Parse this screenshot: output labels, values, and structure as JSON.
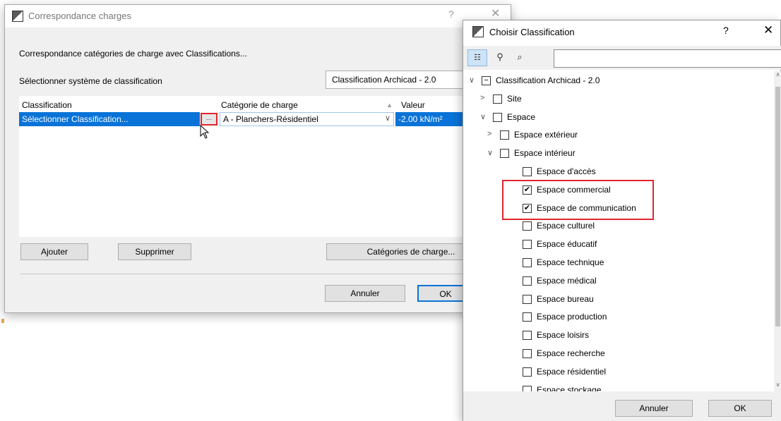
{
  "dialog1": {
    "title": "Correspondance charges",
    "help": "?",
    "close": "✕",
    "heading": "Correspondance catégories de charge avec Classifications...",
    "select_label": "Sélectionner système de classification",
    "select_value": "Classification Archicad - 2.0",
    "columns": {
      "classification": "Classification",
      "category": "Catégorie de charge",
      "value": "Valeur"
    },
    "row": {
      "classification": "Sélectionner Classification...",
      "dots": "...",
      "category": "A - Planchers-Résidentiel",
      "value": "-2.00 kN/m²"
    },
    "buttons": {
      "add": "Ajouter",
      "remove": "Supprimer",
      "categories": "Catégories de charge...",
      "cancel": "Annuler",
      "ok": "OK"
    }
  },
  "dialog2": {
    "title": "Choisir Classification",
    "help": "?",
    "close": "✕",
    "search_value": "",
    "tree": [
      {
        "label": "Classification Archicad - 2.0",
        "arrow": "∨",
        "check": "−",
        "level": 0
      },
      {
        "label": "Site",
        "arrow": ">",
        "check": "",
        "level": 1
      },
      {
        "label": "Espace",
        "arrow": "∨",
        "check": "",
        "level": 1
      },
      {
        "label": "Espace extérieur",
        "arrow": ">",
        "check": "",
        "level": 2
      },
      {
        "label": "Espace intérieur",
        "arrow": "∨",
        "check": "",
        "level": 2
      },
      {
        "label": "Espace d'accès",
        "arrow": "",
        "check": "",
        "level": 3
      },
      {
        "label": "Espace commercial",
        "arrow": "",
        "check": "✔",
        "level": 3
      },
      {
        "label": "Espace de communication",
        "arrow": "",
        "check": "✔",
        "level": 3
      },
      {
        "label": "Espace culturel",
        "arrow": "",
        "check": "",
        "level": 3
      },
      {
        "label": "Espace éducatif",
        "arrow": "",
        "check": "",
        "level": 3
      },
      {
        "label": "Espace technique",
        "arrow": "",
        "check": "",
        "level": 3
      },
      {
        "label": "Espace médical",
        "arrow": "",
        "check": "",
        "level": 3
      },
      {
        "label": "Espace bureau",
        "arrow": "",
        "check": "",
        "level": 3
      },
      {
        "label": "Espace production",
        "arrow": "",
        "check": "",
        "level": 3
      },
      {
        "label": "Espace loisirs",
        "arrow": "",
        "check": "",
        "level": 3
      },
      {
        "label": "Espace recherche",
        "arrow": "",
        "check": "",
        "level": 3
      },
      {
        "label": "Espace résidentiel",
        "arrow": "",
        "check": "",
        "level": 3
      },
      {
        "label": "Espace stockage",
        "arrow": "",
        "check": "",
        "level": 3
      }
    ],
    "buttons": {
      "cancel": "Annuler",
      "ok": "OK"
    }
  },
  "colors": {
    "selection": "#0a73d8",
    "highlight": "#e0262c",
    "dialog_bg": "#f0f0f0"
  },
  "icons": [
    "archicad-logo-icon",
    "tree-view-icon",
    "filter-icon",
    "search-icon",
    "chevron-down-icon",
    "chevron-right-icon",
    "checkbox-icon",
    "mouse-cursor-icon"
  ]
}
